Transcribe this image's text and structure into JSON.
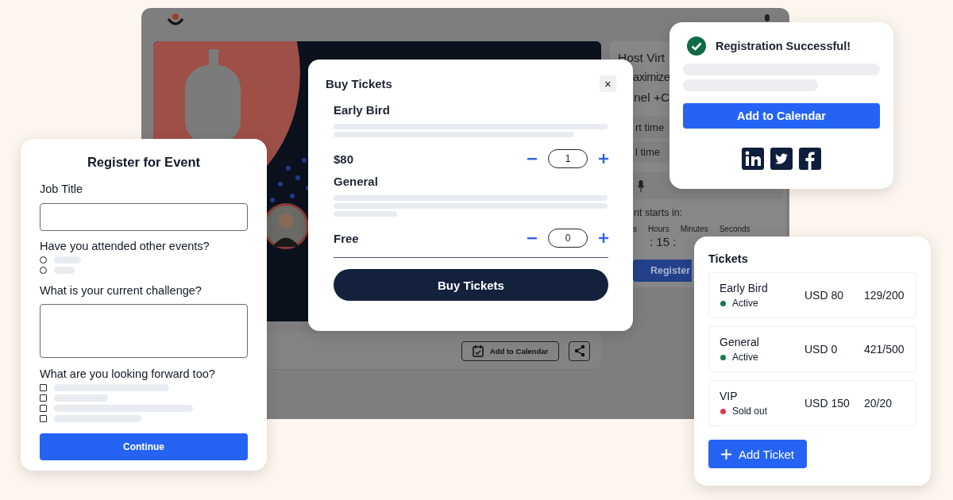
{
  "event_window": {
    "title_lines": [
      "Host Virt",
      "aximize",
      "nel +C"
    ],
    "fields": [
      "rt time",
      "l time"
    ],
    "countdown_label": "nt starts in:",
    "countdown_units": [
      "s",
      "Hours",
      "Minutes",
      "Seconds"
    ],
    "countdown_value": ": 15 :",
    "register_button": "Register",
    "calendar_button": "Add to Calendar"
  },
  "register_form": {
    "title": "Register for Event",
    "questions": [
      {
        "kind": "text",
        "label": "Job Title"
      },
      {
        "kind": "radio",
        "label": "Have you attended other events?",
        "options": [
          {
            "selected": false
          },
          {
            "selected": false
          }
        ]
      },
      {
        "kind": "textarea",
        "label": "What is your current challenge?"
      },
      {
        "kind": "checkbox",
        "label": "What are you looking forward too?",
        "options": [
          {
            "checked": false
          },
          {
            "checked": false
          },
          {
            "checked": false
          },
          {
            "checked": false
          }
        ]
      }
    ],
    "button": "Continue"
  },
  "buy_tickets": {
    "title": "Buy Tickets",
    "close": "×",
    "tickets": [
      {
        "name": "Early Bird",
        "price": "$80",
        "quantity": "1"
      },
      {
        "name": "General",
        "price": "Free",
        "quantity": "0"
      }
    ],
    "button": "Buy Tickets"
  },
  "confirmation": {
    "title": "Registration Successful!",
    "button": "Add to Calendar"
  },
  "tickets_panel": {
    "title": "Tickets",
    "rows": [
      {
        "name": "Early Bird",
        "status": "Active",
        "color": "#157a4f",
        "price": "USD 80",
        "sold": "129/200"
      },
      {
        "name": "General",
        "status": "Active",
        "color": "#157a4f",
        "price": "USD 0",
        "sold": "421/500"
      },
      {
        "name": "VIP",
        "status": "Sold out",
        "color": "#e0364d",
        "price": "USD 150",
        "sold": "20/20"
      }
    ],
    "button": "Add Ticket"
  }
}
